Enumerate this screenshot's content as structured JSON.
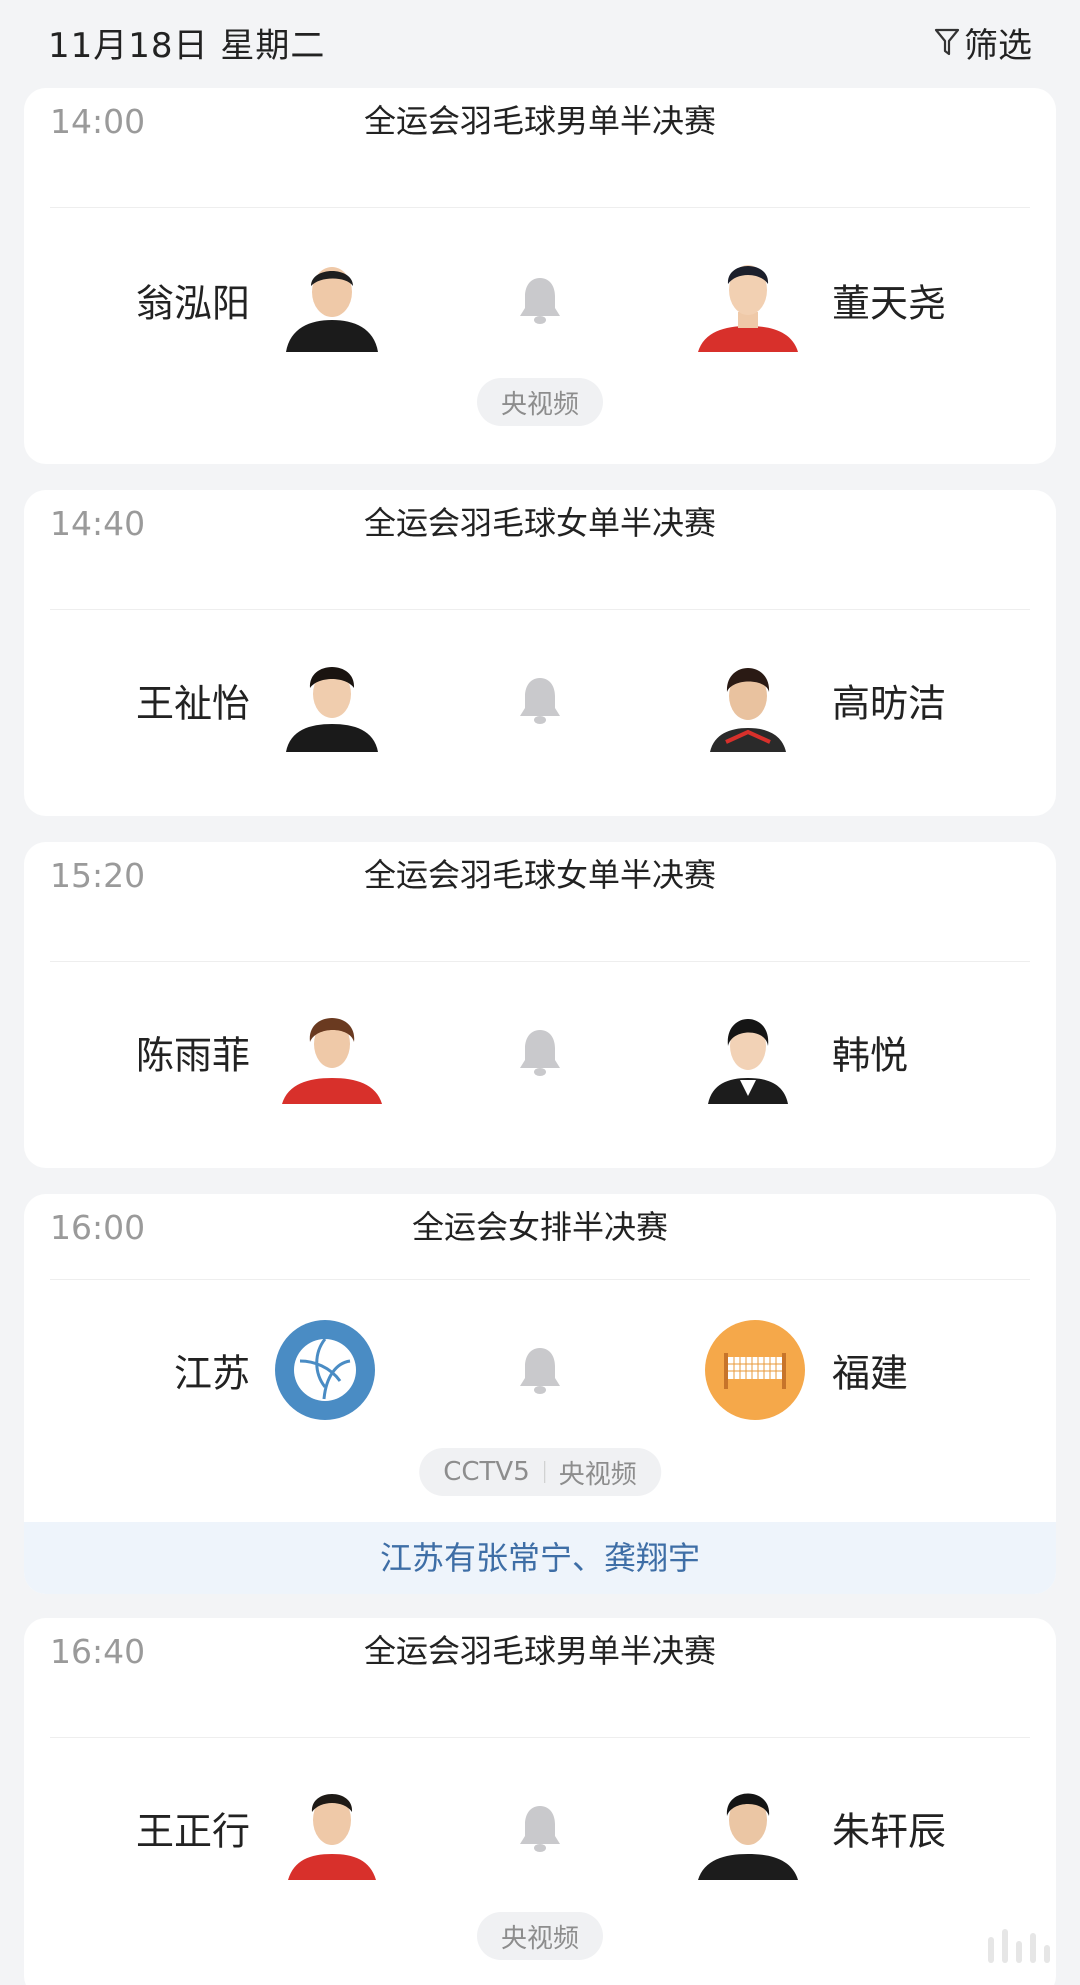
{
  "header": {
    "date": "11月18日 星期二",
    "filter_label": "筛选"
  },
  "matches": [
    {
      "time": "14:00",
      "title": "全运会羽毛球男单半决赛",
      "left": "翁泓阳",
      "right": "董天尧",
      "channels": [
        "央视频"
      ]
    },
    {
      "time": "14:40",
      "title": "全运会羽毛球女单半决赛",
      "left": "王祉怡",
      "right": "高昉洁",
      "channels": []
    },
    {
      "time": "15:20",
      "title": "全运会羽毛球女单半决赛",
      "left": "陈雨菲",
      "right": "韩悦",
      "channels": []
    },
    {
      "time": "16:00",
      "title": "全运会女排半决赛",
      "left": "江苏",
      "right": "福建",
      "channels": [
        "CCTV5",
        "央视频"
      ],
      "note": "江苏有张常宁、龚翔宇"
    },
    {
      "time": "16:40",
      "title": "全运会羽毛球男单半决赛",
      "left": "王正行",
      "right": "朱轩辰",
      "channels": [
        "央视频"
      ]
    }
  ],
  "colors": {
    "note_bg": "#eef4fb",
    "note_text": "#3e6ea6",
    "team_left": "#4a8cc4",
    "team_right": "#f5a84a"
  },
  "icons": {
    "filter": "filter-icon",
    "bell": "bell-icon",
    "volleyball": "volleyball-icon",
    "net": "net-icon"
  }
}
